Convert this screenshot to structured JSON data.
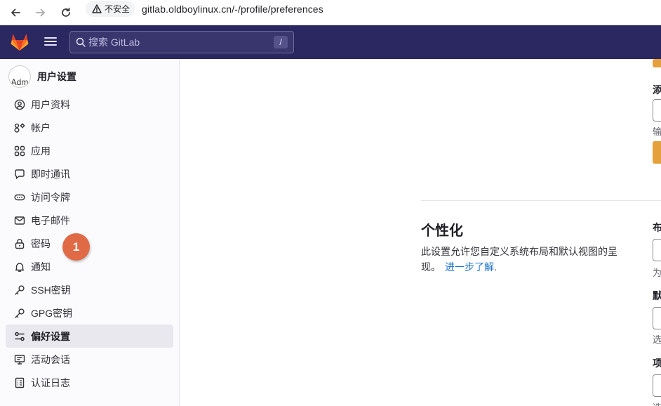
{
  "browser": {
    "security_label": "不安全",
    "url": "gitlab.oldboylinux.cn/-/profile/preferences"
  },
  "topbar": {
    "search_placeholder": "搜索 GitLab",
    "search_shortcut": "/"
  },
  "sidebar": {
    "avatar_alt": "Adm",
    "title": "用户设置",
    "items": [
      {
        "label": "用户资料",
        "icon": "user-circle-icon"
      },
      {
        "label": "帐户",
        "icon": "account-gear-icon"
      },
      {
        "label": "应用",
        "icon": "applications-icon"
      },
      {
        "label": "即时通讯",
        "icon": "chat-icon"
      },
      {
        "label": "访问令牌",
        "icon": "token-icon"
      },
      {
        "label": "电子邮件",
        "icon": "mail-icon"
      },
      {
        "label": "密码",
        "icon": "lock-icon"
      },
      {
        "label": "通知",
        "icon": "bell-icon"
      },
      {
        "label": "SSH密钥",
        "icon": "key-icon"
      },
      {
        "label": "GPG密钥",
        "icon": "key-icon"
      },
      {
        "label": "偏好设置",
        "icon": "preferences-icon",
        "active": true
      },
      {
        "label": "活动会话",
        "icon": "monitor-icon"
      },
      {
        "label": "认证日志",
        "icon": "log-icon"
      }
    ]
  },
  "annotation": {
    "step_number": "1",
    "color": "#e06a45"
  },
  "main": {
    "cut_label_1": "添",
    "cut_help_1": "输",
    "section": {
      "title": "个性化",
      "description": "此设置允许您自定义系统布局和默认视图的呈现。",
      "learn_more": "进一步了解",
      "trailing_period": "."
    },
    "cut_label_2": "布",
    "cut_help_2": "为",
    "cut_label_3": "默",
    "cut_help_3": "选",
    "cut_label_4": "项",
    "cut_help_4": "选"
  },
  "colors": {
    "navbar": "#2b2760",
    "accent_orange": "#e5a03e",
    "link": "#1f75cb"
  }
}
